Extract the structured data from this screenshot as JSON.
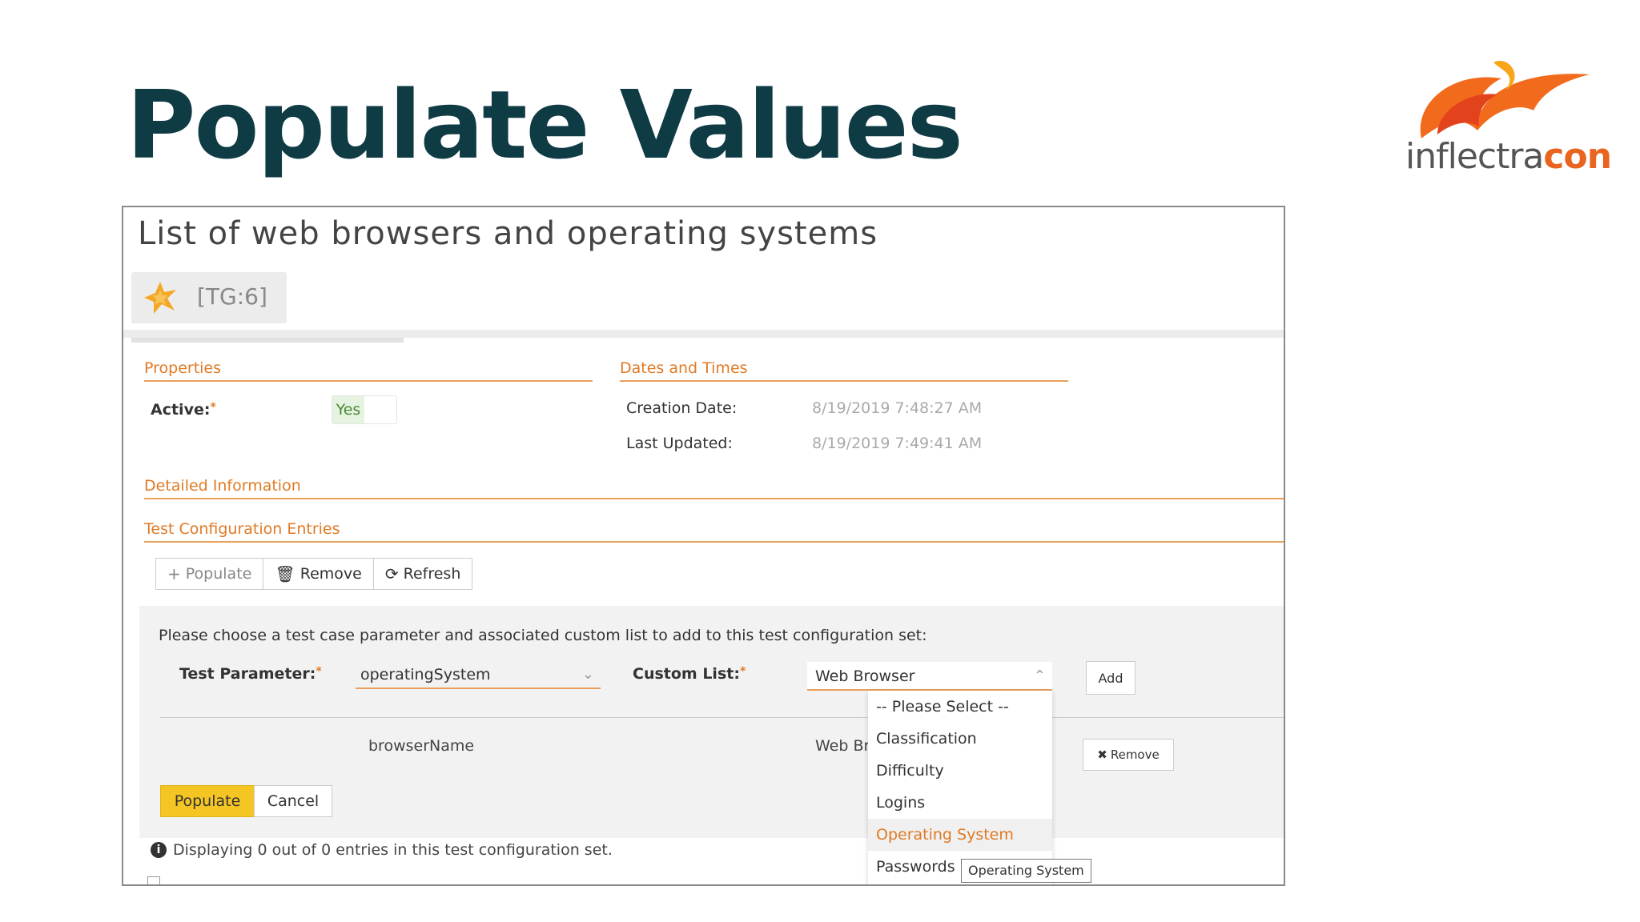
{
  "slide": {
    "title": "Populate Values"
  },
  "logo": {
    "text_main": "inflectra",
    "text_accent": "con"
  },
  "artifact": {
    "title": "List of web browsers and operating systems",
    "id": "[TG:6]"
  },
  "properties": {
    "heading": "Properties",
    "active_label": "Active:",
    "active_value": "Yes",
    "required_mark": "*"
  },
  "dates": {
    "heading": "Dates and Times",
    "creation_label": "Creation Date:",
    "creation_value": "8/19/2019 7:48:27 AM",
    "updated_label": "Last Updated:",
    "updated_value": "8/19/2019 7:49:41 AM"
  },
  "detailed": {
    "heading": "Detailed Information"
  },
  "entries": {
    "heading": "Test Configuration Entries",
    "toolbar": {
      "populate": "Populate",
      "remove": "Remove",
      "refresh": "Refresh"
    }
  },
  "populate_panel": {
    "instructions": "Please choose a test case parameter and associated custom list to add to this test configuration set:",
    "test_param_label": "Test Parameter:",
    "test_param_value": "operatingSystem",
    "custom_list_label": "Custom List:",
    "custom_list_value": "Web Browser",
    "add_label": "Add",
    "row_param": "browserName",
    "row_list": "Web Br",
    "row_remove": "Remove",
    "populate_label": "Populate",
    "cancel_label": "Cancel"
  },
  "dropdown": {
    "options": [
      "-- Please Select --",
      "Classification",
      "Difficulty",
      "Logins",
      "Operating System",
      "Passwords"
    ],
    "tooltip": "Operating System"
  },
  "footer": {
    "info": "Displaying 0 out of 0 entries in this test configuration set."
  },
  "colors": {
    "accent": "#e07a25",
    "title": "#0f3b45",
    "populate_button": "#f5c623"
  }
}
